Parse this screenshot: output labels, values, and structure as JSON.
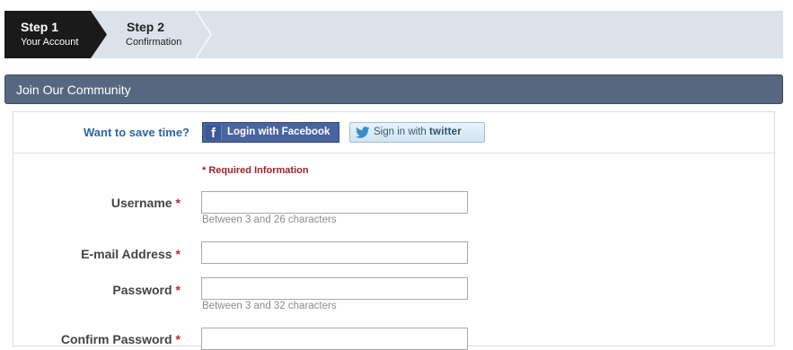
{
  "steps": [
    {
      "title": "Step 1",
      "subtitle": "Your Account",
      "active": true
    },
    {
      "title": "Step 2",
      "subtitle": "Confirmation",
      "active": false
    }
  ],
  "section": {
    "title": "Join Our Community"
  },
  "social": {
    "prompt": "Want to save time?",
    "facebook_icon": "f",
    "facebook_label": "Login with Facebook",
    "twitter_prefix": "Sign in with",
    "twitter_logo": "twitter"
  },
  "form": {
    "required_note": "* Required Information",
    "required_marker": "*",
    "fields": [
      {
        "label": "Username",
        "value": "",
        "hint": "Between 3 and 26 characters"
      },
      {
        "label": "E-mail Address",
        "value": "",
        "hint": ""
      },
      {
        "label": "Password",
        "value": "",
        "hint": "Between 3 and 32 characters"
      },
      {
        "label": "Confirm Password",
        "value": "",
        "hint": ""
      }
    ]
  },
  "colors": {
    "active_step": "#1a1a1a",
    "steps_bar": "#dde2ea",
    "header": "#566780",
    "link_blue": "#2a66a8",
    "required_red": "#a0222b",
    "facebook": "#4a64a0"
  }
}
